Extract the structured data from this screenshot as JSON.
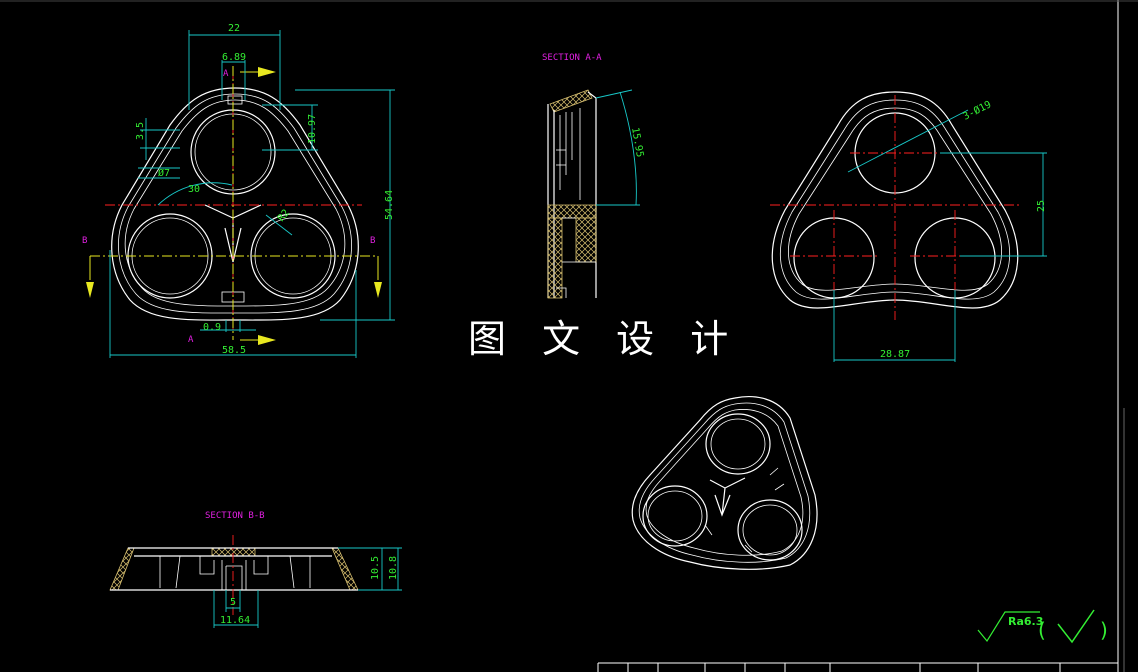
{
  "watermark": "图 文 设 计",
  "colors": {
    "background": "#000000",
    "outline": "#ffffff",
    "dimension": "#18c8c8",
    "dimension_text": "#33ee33",
    "centerline": "#ff2020",
    "section_label": "#e020e0",
    "section_line": "#e8e820"
  },
  "front_view": {
    "dims": [
      "22",
      "6.89",
      "3.5",
      "10.97",
      "54.64",
      "30",
      "0.9",
      "58.5",
      "Ø7",
      "R2"
    ],
    "labels": {
      "a_top": "A",
      "a_bottom": "A",
      "b_left": "B",
      "b_right": "B"
    }
  },
  "section_aa": {
    "title": "SECTION A-A",
    "dims": [
      "15.95"
    ]
  },
  "section_bb": {
    "title": "SECTION B-B",
    "dims": [
      "10.5",
      "10.8",
      "5",
      "11.64"
    ]
  },
  "right_view": {
    "dims": [
      "3-Ø19",
      "25",
      "28.87"
    ]
  },
  "roughness": {
    "label": "Ra6.3"
  }
}
